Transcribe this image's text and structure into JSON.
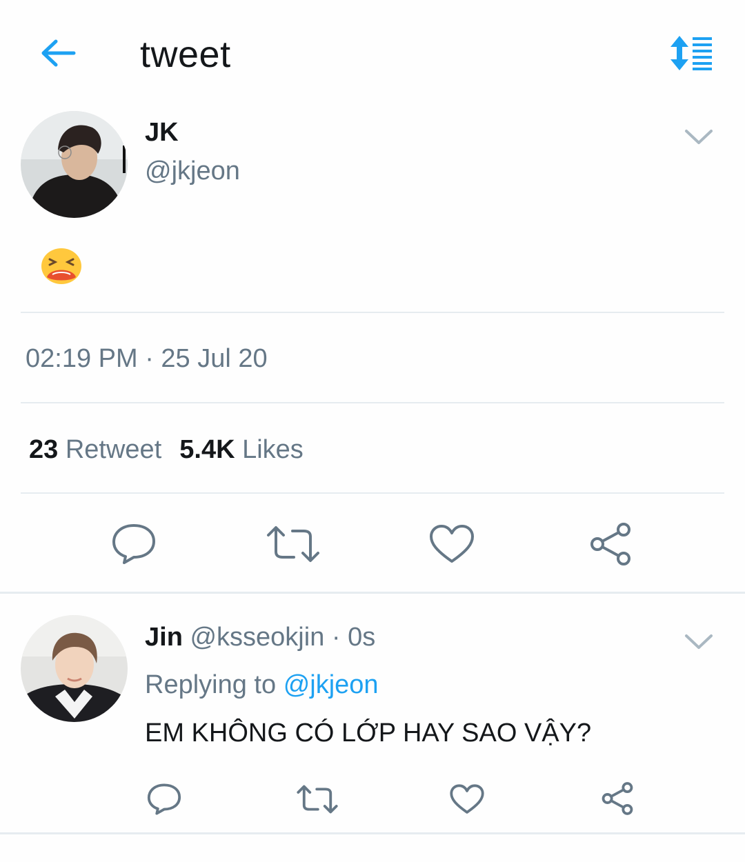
{
  "header": {
    "title": "tweet",
    "back_icon": "arrow-left-icon",
    "sort_icon": "sort-list-icon"
  },
  "colors": {
    "accent": "#1da1f2",
    "secondary_text": "#657786",
    "primary_text": "#14171a",
    "divider": "#e6ecf0"
  },
  "tweet": {
    "display_name": "JK",
    "handle": "@jkjeon",
    "content_emoji": "😫",
    "timestamp": "02:19 PM · 25 Jul 20",
    "stats": {
      "retweets_count": "23",
      "retweets_label": "Retweet",
      "likes_count": "5.4K",
      "likes_label": "Likes"
    }
  },
  "actions": [
    "reply-icon",
    "retweet-icon",
    "like-icon",
    "share-icon"
  ],
  "reply": {
    "display_name": "Jin",
    "handle_time": "@ksseokjin · 0s",
    "replying_to_label": "Replying to",
    "replying_to_handle": "@jkjeon",
    "text": "EM KHÔNG CÓ LỚP HAY SAO VẬY?"
  }
}
